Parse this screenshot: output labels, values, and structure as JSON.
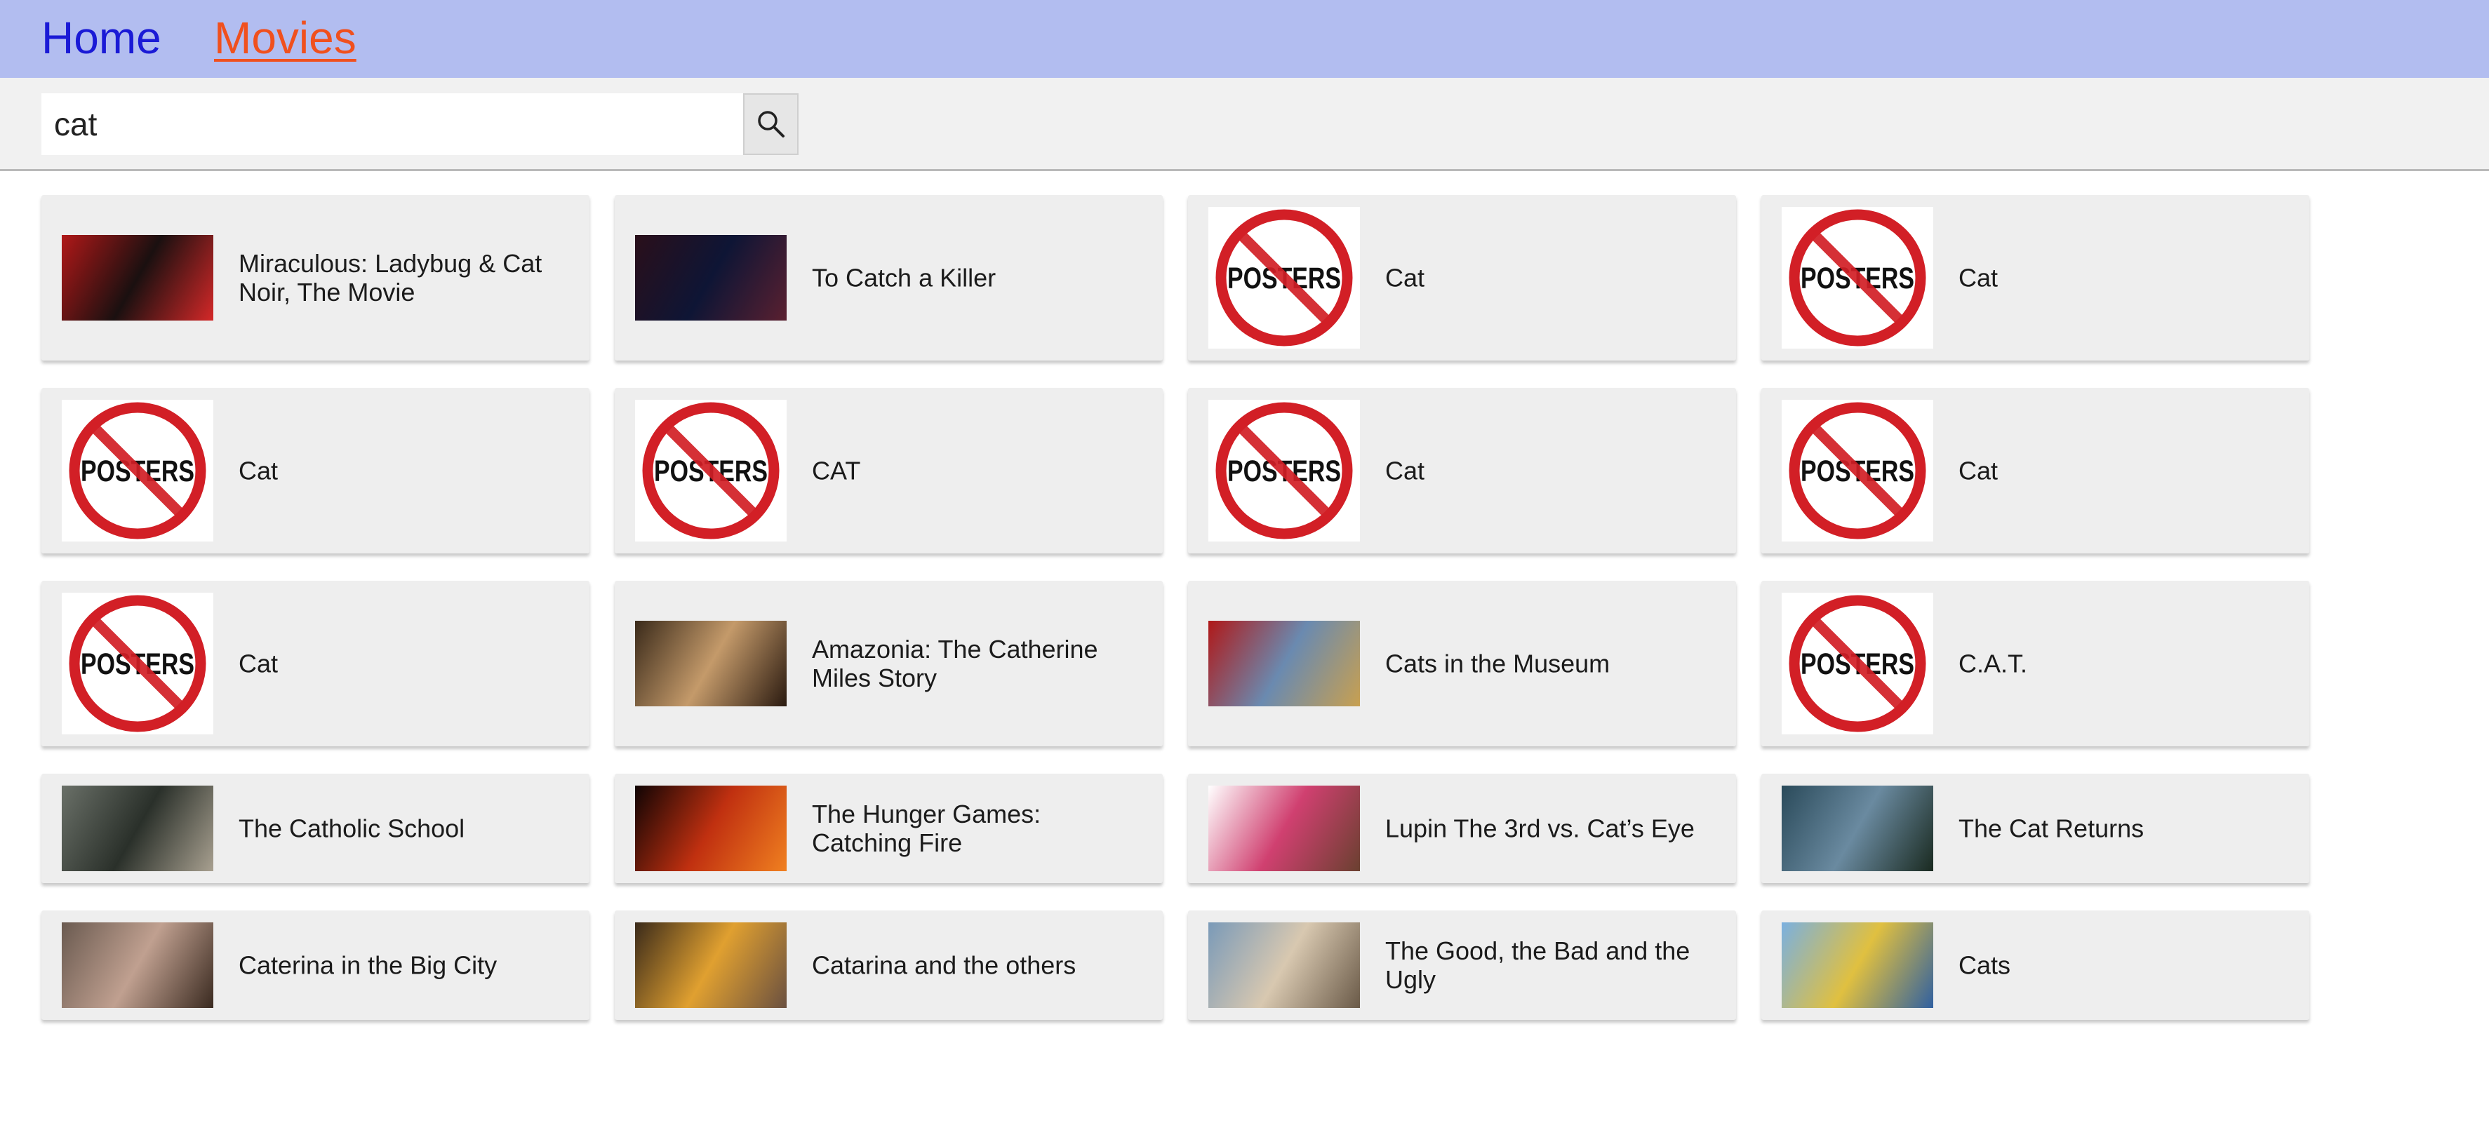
{
  "nav": {
    "home_label": "Home",
    "movies_label": "Movies"
  },
  "search": {
    "value": "cat",
    "button_icon": "search-icon"
  },
  "poster_placeholder_text": "POSTERS",
  "movies": [
    {
      "title": "Miraculous: Ladybug & Cat Noir, The Movie",
      "poster": "image",
      "colors": [
        "#b01818",
        "#1a1010",
        "#d42828"
      ]
    },
    {
      "title": "To Catch a Killer",
      "poster": "image",
      "colors": [
        "#2a0f1a",
        "#0e1535",
        "#5a2030"
      ]
    },
    {
      "title": "Cat",
      "poster": "none"
    },
    {
      "title": "Cat",
      "poster": "none"
    },
    {
      "title": "Cat",
      "poster": "none"
    },
    {
      "title": "CAT",
      "poster": "none"
    },
    {
      "title": "Cat",
      "poster": "none"
    },
    {
      "title": "Cat",
      "poster": "none"
    },
    {
      "title": "Cat",
      "poster": "none"
    },
    {
      "title": "Amazonia: The Catherine Miles Story",
      "poster": "image",
      "colors": [
        "#3a2a1a",
        "#c49a6a",
        "#2a1a10"
      ]
    },
    {
      "title": "Cats in the Museum",
      "poster": "image",
      "colors": [
        "#b01818",
        "#6a8ab0",
        "#c8a050"
      ]
    },
    {
      "title": "C.A.T.",
      "poster": "none"
    },
    {
      "title": "The Catholic School",
      "poster": "image",
      "colors": [
        "#6a7068",
        "#2a302a",
        "#a8a090"
      ]
    },
    {
      "title": "The Hunger Games: Catching Fire",
      "poster": "image",
      "colors": [
        "#100404",
        "#c03010",
        "#f08020"
      ]
    },
    {
      "title": "Lupin The 3rd vs. Cat’s Eye",
      "poster": "image",
      "colors": [
        "#ffffff",
        "#d04070",
        "#6a4030"
      ]
    },
    {
      "title": "The Cat Returns",
      "poster": "image",
      "colors": [
        "#2a4a5a",
        "#6a8aa0",
        "#1a2a20"
      ]
    },
    {
      "title": "Caterina in the Big City",
      "poster": "image",
      "colors": [
        "#6a5a50",
        "#c0a090",
        "#3a2a20"
      ]
    },
    {
      "title": "Catarina and the others",
      "poster": "image",
      "colors": [
        "#3a2a1a",
        "#e0a030",
        "#6a5040"
      ]
    },
    {
      "title": "The Good, the Bad and the Ugly",
      "poster": "image",
      "colors": [
        "#7a9ab8",
        "#d8c8b0",
        "#6a5a48"
      ]
    },
    {
      "title": "Cats",
      "poster": "image",
      "colors": [
        "#7ab0e0",
        "#e0c040",
        "#3060a0"
      ]
    }
  ]
}
